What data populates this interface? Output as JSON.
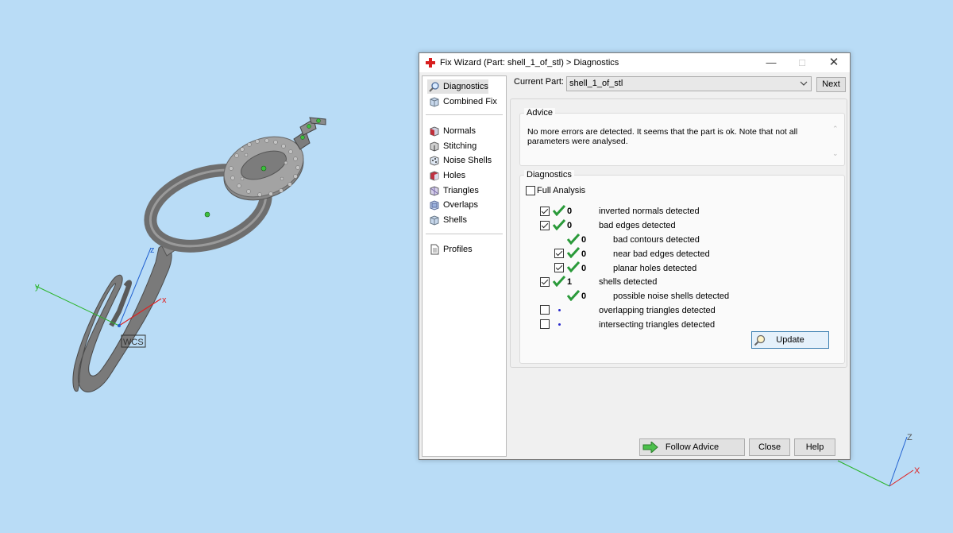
{
  "viewport": {
    "wcs_label": "WCS",
    "axes": {
      "x": "x",
      "y": "y",
      "z": "z"
    },
    "corner_axes": {
      "x": "X",
      "z": "Z"
    }
  },
  "dialog": {
    "title": "Fix Wizard (Part: shell_1_of_stl) > Diagnostics",
    "nav": [
      {
        "label": "Diagnostics",
        "icon": "magnifier-icon"
      },
      {
        "label": "Combined Fix",
        "icon": "cube-icon"
      },
      {
        "label": "Normals",
        "icon": "normals-cube-icon"
      },
      {
        "label": "Stitching",
        "icon": "stitching-icon"
      },
      {
        "label": "Noise Shells",
        "icon": "noise-shells-icon"
      },
      {
        "label": "Holes",
        "icon": "holes-icon"
      },
      {
        "label": "Triangles",
        "icon": "triangles-icon"
      },
      {
        "label": "Overlaps",
        "icon": "overlaps-icon"
      },
      {
        "label": "Shells",
        "icon": "shells-icon"
      },
      {
        "label": "Profiles",
        "icon": "document-icon"
      }
    ],
    "current_part_label": "Current Part:",
    "current_part_value": "shell_1_of_stl",
    "next_label": "Next",
    "advice": {
      "title": "Advice",
      "text": "No more errors are detected. It seems that the part is ok. Note that not all parameters were analysed."
    },
    "diagnostics": {
      "title": "Diagnostics",
      "full_analysis_label": "Full Analysis",
      "full_analysis_checked": false,
      "rows": [
        {
          "checked": true,
          "status": "ok",
          "count": "0",
          "label": "inverted normals detected"
        },
        {
          "checked": true,
          "status": "ok",
          "count": "0",
          "label": "bad edges detected"
        },
        {
          "checked": null,
          "status": "ok",
          "count": "0",
          "label": "bad contours detected"
        },
        {
          "checked": true,
          "status": "ok",
          "count": "0",
          "label": "near bad edges detected"
        },
        {
          "checked": true,
          "status": "ok",
          "count": "0",
          "label": "planar holes detected"
        },
        {
          "checked": true,
          "status": "ok",
          "count": "1",
          "label": "shells detected"
        },
        {
          "checked": null,
          "status": "ok",
          "count": "0",
          "label": "possible noise shells detected"
        },
        {
          "checked": false,
          "status": "none",
          "count": "",
          "label": "overlapping triangles detected"
        },
        {
          "checked": false,
          "status": "none",
          "count": "",
          "label": "intersecting triangles detected"
        }
      ],
      "update_label": "Update"
    },
    "follow_advice_label": "Follow Advice",
    "close_label": "Close",
    "help_label": "Help"
  }
}
